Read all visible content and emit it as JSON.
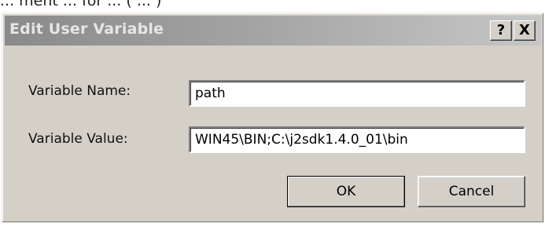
{
  "background": {
    "partial_text": "... ment ... for ... ( ... )"
  },
  "dialog": {
    "title": "Edit User Variable",
    "help_button": "?",
    "close_button": "X"
  },
  "form": {
    "name_label": "Variable Name:",
    "name_value": "path",
    "value_label": "Variable Value:",
    "value_value": "WIN45\\BIN;C:\\j2sdk1.4.0_01\\bin"
  },
  "buttons": {
    "ok": "OK",
    "cancel": "Cancel"
  },
  "colors": {
    "dialog_face": "#d4d0c8",
    "titlebar_inactive_start": "#8a8a8a",
    "titlebar_inactive_end": "#c7c7c7"
  }
}
